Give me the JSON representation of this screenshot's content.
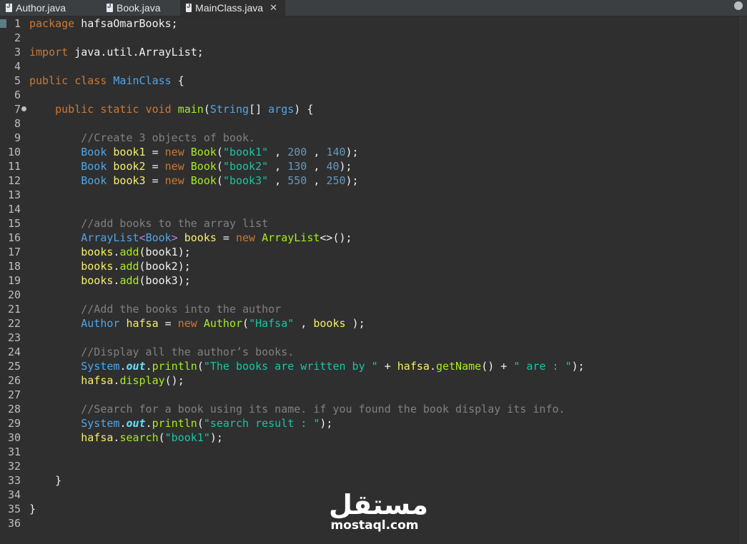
{
  "tabs": [
    {
      "label": "Author.java",
      "active": false
    },
    {
      "label": "Book.java",
      "active": false
    },
    {
      "label": "MainClass.java",
      "active": true
    }
  ],
  "editor": {
    "lines": [
      {
        "n": "1",
        "tokens": [
          [
            "kw",
            "package"
          ],
          [
            "pl",
            " hafsaOmarBooks;"
          ]
        ]
      },
      {
        "n": "2",
        "tokens": []
      },
      {
        "n": "3",
        "tokens": [
          [
            "kw",
            "import"
          ],
          [
            "pl",
            " java.util.ArrayList;"
          ]
        ]
      },
      {
        "n": "4",
        "tokens": []
      },
      {
        "n": "5",
        "tokens": [
          [
            "kw",
            "public"
          ],
          [
            "pl",
            " "
          ],
          [
            "kw",
            "class"
          ],
          [
            "pl",
            " "
          ],
          [
            "cls",
            "MainClass"
          ],
          [
            "pl",
            " {"
          ]
        ]
      },
      {
        "n": "6",
        "tokens": []
      },
      {
        "n": "7",
        "breakpoint": true,
        "tokens": [
          [
            "pl",
            "    "
          ],
          [
            "kw",
            "public"
          ],
          [
            "pl",
            " "
          ],
          [
            "kw",
            "static"
          ],
          [
            "pl",
            " "
          ],
          [
            "kw",
            "void"
          ],
          [
            "pl",
            " "
          ],
          [
            "mth",
            "main"
          ],
          [
            "pl",
            "("
          ],
          [
            "cls",
            "String"
          ],
          [
            "pl",
            "[] "
          ],
          [
            "cls",
            "args"
          ],
          [
            "pl",
            ") {"
          ]
        ]
      },
      {
        "n": "8",
        "tokens": []
      },
      {
        "n": "9",
        "tokens": [
          [
            "pl",
            "        "
          ],
          [
            "cmt",
            "//Create 3 objects of book."
          ]
        ]
      },
      {
        "n": "10",
        "tokens": [
          [
            "pl",
            "        "
          ],
          [
            "cls",
            "Book"
          ],
          [
            "pl",
            " "
          ],
          [
            "var",
            "book1"
          ],
          [
            "pl",
            " = "
          ],
          [
            "kw",
            "new"
          ],
          [
            "pl",
            " "
          ],
          [
            "mth",
            "Book"
          ],
          [
            "pl",
            "("
          ],
          [
            "str",
            "\"book1\""
          ],
          [
            "pl",
            " , "
          ],
          [
            "num",
            "200"
          ],
          [
            "pl",
            " , "
          ],
          [
            "num",
            "140"
          ],
          [
            "pl",
            ");"
          ]
        ]
      },
      {
        "n": "11",
        "tokens": [
          [
            "pl",
            "        "
          ],
          [
            "cls",
            "Book"
          ],
          [
            "pl",
            " "
          ],
          [
            "var",
            "book2"
          ],
          [
            "pl",
            " = "
          ],
          [
            "kw",
            "new"
          ],
          [
            "pl",
            " "
          ],
          [
            "mth",
            "Book"
          ],
          [
            "pl",
            "("
          ],
          [
            "str",
            "\"book2\""
          ],
          [
            "pl",
            " , "
          ],
          [
            "num",
            "130"
          ],
          [
            "pl",
            " , "
          ],
          [
            "num",
            "40"
          ],
          [
            "pl",
            ");"
          ]
        ]
      },
      {
        "n": "12",
        "tokens": [
          [
            "pl",
            "        "
          ],
          [
            "cls",
            "Book"
          ],
          [
            "pl",
            " "
          ],
          [
            "var",
            "book3"
          ],
          [
            "pl",
            " = "
          ],
          [
            "kw",
            "new"
          ],
          [
            "pl",
            " "
          ],
          [
            "mth",
            "Book"
          ],
          [
            "pl",
            "("
          ],
          [
            "str",
            "\"book3\""
          ],
          [
            "pl",
            " , "
          ],
          [
            "num",
            "550"
          ],
          [
            "pl",
            " , "
          ],
          [
            "num",
            "250"
          ],
          [
            "pl",
            ");"
          ]
        ]
      },
      {
        "n": "13",
        "tokens": []
      },
      {
        "n": "14",
        "tokens": []
      },
      {
        "n": "15",
        "tokens": [
          [
            "pl",
            "        "
          ],
          [
            "cmt",
            "//add books to the array list"
          ]
        ]
      },
      {
        "n": "16",
        "tokens": [
          [
            "pl",
            "        "
          ],
          [
            "cls",
            "ArrayList"
          ],
          [
            "gen",
            "<"
          ],
          [
            "cls",
            "Book"
          ],
          [
            "gen",
            ">"
          ],
          [
            "pl",
            " "
          ],
          [
            "var",
            "books"
          ],
          [
            "pl",
            " = "
          ],
          [
            "kw",
            "new"
          ],
          [
            "pl",
            " "
          ],
          [
            "mth",
            "ArrayList"
          ],
          [
            "pl",
            "<>();"
          ]
        ]
      },
      {
        "n": "17",
        "tokens": [
          [
            "pl",
            "        "
          ],
          [
            "var",
            "books"
          ],
          [
            "pl",
            "."
          ],
          [
            "mth",
            "add"
          ],
          [
            "pl",
            "(book1);"
          ]
        ]
      },
      {
        "n": "18",
        "tokens": [
          [
            "pl",
            "        "
          ],
          [
            "var",
            "books"
          ],
          [
            "pl",
            "."
          ],
          [
            "mth",
            "add"
          ],
          [
            "pl",
            "(book2);"
          ]
        ]
      },
      {
        "n": "19",
        "tokens": [
          [
            "pl",
            "        "
          ],
          [
            "var",
            "books"
          ],
          [
            "pl",
            "."
          ],
          [
            "mth",
            "add"
          ],
          [
            "pl",
            "(book3);"
          ]
        ]
      },
      {
        "n": "20",
        "tokens": []
      },
      {
        "n": "21",
        "tokens": [
          [
            "pl",
            "        "
          ],
          [
            "cmt",
            "//Add the books into the author"
          ]
        ]
      },
      {
        "n": "22",
        "tokens": [
          [
            "pl",
            "        "
          ],
          [
            "cls",
            "Author"
          ],
          [
            "pl",
            " "
          ],
          [
            "var",
            "hafsa"
          ],
          [
            "pl",
            " = "
          ],
          [
            "kw",
            "new"
          ],
          [
            "pl",
            " "
          ],
          [
            "mth",
            "Author"
          ],
          [
            "pl",
            "("
          ],
          [
            "str",
            "\"Hafsa\""
          ],
          [
            "pl",
            " , "
          ],
          [
            "var",
            "books"
          ],
          [
            "pl",
            " );"
          ]
        ]
      },
      {
        "n": "23",
        "tokens": []
      },
      {
        "n": "24",
        "tokens": [
          [
            "pl",
            "        "
          ],
          [
            "cmt",
            "//Display all the author’s books."
          ]
        ]
      },
      {
        "n": "25",
        "tokens": [
          [
            "pl",
            "        "
          ],
          [
            "cls",
            "System"
          ],
          [
            "pl",
            "."
          ],
          [
            "fld",
            "out"
          ],
          [
            "pl",
            "."
          ],
          [
            "mth",
            "println"
          ],
          [
            "pl",
            "("
          ],
          [
            "str",
            "\"The books are written by \""
          ],
          [
            "pl",
            " + "
          ],
          [
            "var",
            "hafsa"
          ],
          [
            "pl",
            "."
          ],
          [
            "mth",
            "getName"
          ],
          [
            "pl",
            "() + "
          ],
          [
            "str",
            "\" are : \""
          ],
          [
            "pl",
            ");"
          ]
        ]
      },
      {
        "n": "26",
        "tokens": [
          [
            "pl",
            "        "
          ],
          [
            "var",
            "hafsa"
          ],
          [
            "pl",
            "."
          ],
          [
            "mth",
            "display"
          ],
          [
            "pl",
            "();"
          ]
        ]
      },
      {
        "n": "27",
        "tokens": []
      },
      {
        "n": "28",
        "tokens": [
          [
            "pl",
            "        "
          ],
          [
            "cmt",
            "//Search for a book using its name. if you found the book display its info."
          ]
        ]
      },
      {
        "n": "29",
        "tokens": [
          [
            "pl",
            "        "
          ],
          [
            "cls",
            "System"
          ],
          [
            "pl",
            "."
          ],
          [
            "fld",
            "out"
          ],
          [
            "pl",
            "."
          ],
          [
            "mth",
            "println"
          ],
          [
            "pl",
            "("
          ],
          [
            "str",
            "\"search result : \""
          ],
          [
            "pl",
            ");"
          ]
        ]
      },
      {
        "n": "30",
        "tokens": [
          [
            "pl",
            "        "
          ],
          [
            "var",
            "hafsa"
          ],
          [
            "pl",
            "."
          ],
          [
            "mth",
            "search"
          ],
          [
            "pl",
            "("
          ],
          [
            "str",
            "\"book1\""
          ],
          [
            "pl",
            ");"
          ]
        ]
      },
      {
        "n": "31",
        "tokens": []
      },
      {
        "n": "32",
        "tokens": []
      },
      {
        "n": "33",
        "tokens": [
          [
            "pl",
            "    }"
          ]
        ]
      },
      {
        "n": "34",
        "tokens": []
      },
      {
        "n": "35",
        "tokens": [
          [
            "pl",
            "}"
          ]
        ]
      },
      {
        "n": "36",
        "tokens": []
      }
    ]
  },
  "watermark": {
    "logo_text": "مستقل",
    "url": "mostaql.com"
  }
}
